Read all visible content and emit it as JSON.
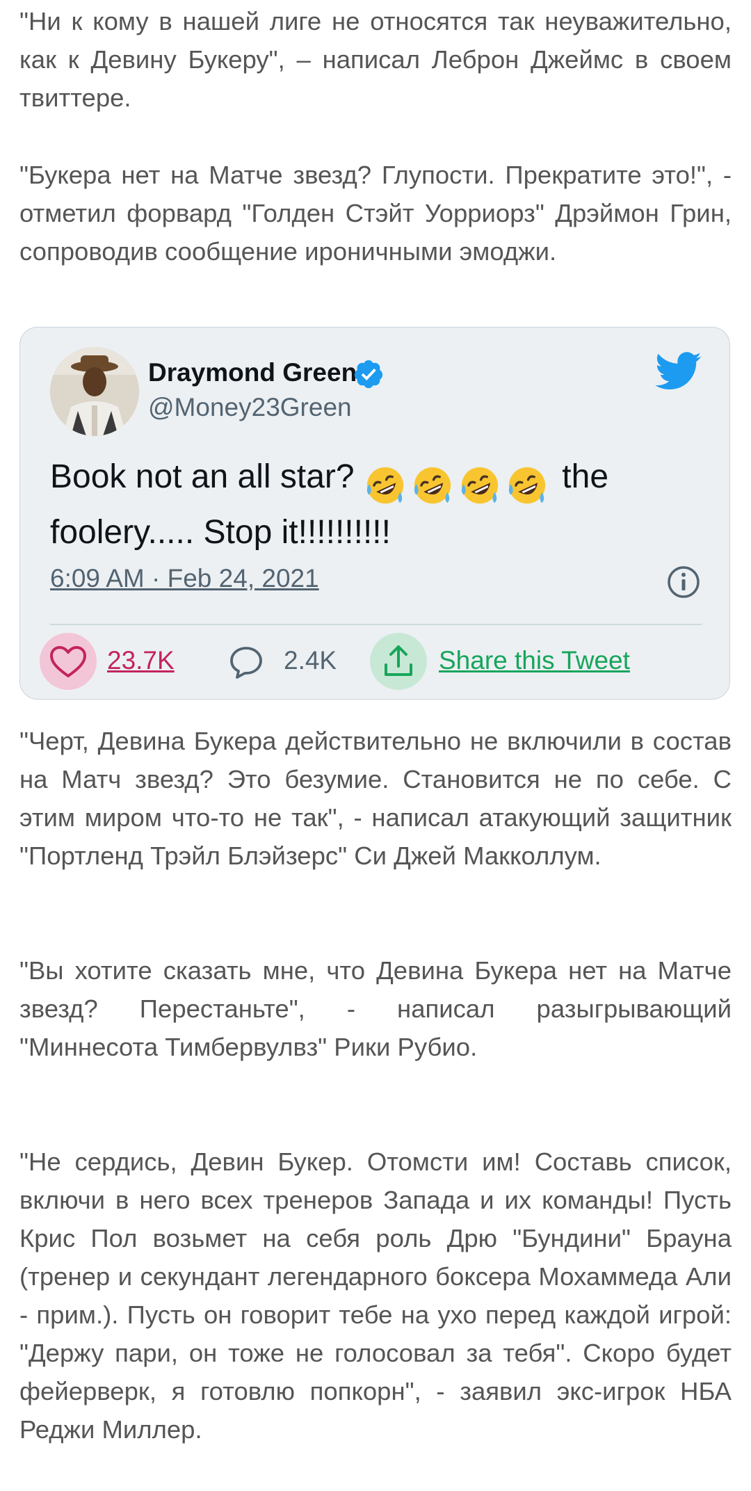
{
  "article": {
    "paragraph_1": "\"Ни к кому в нашей лиге не относятся так неуважительно, как к Девину Букеру\", – написал Леброн Джеймс в своем твиттере.",
    "paragraph_2": "\"Букера нет на Матче звезд? Глупости. Прекратите это!\", - отметил форвард \"Голден Стэйт Уорриорз\" Дрэймон Грин, сопроводив сообщение ироничными эмоджи.",
    "paragraph_3": "\"Черт, Девина Букера действительно не включили в состав на Матч звезд? Это безумие. Становится не по себе. С этим миром что-то не так\", - написал атакующий защитник \"Портленд Трэйл Блэйзерс\" Си Джей Макколлум.",
    "paragraph_4": "\"Вы хотите сказать мне, что Девина Букера нет на Матче звезд? Перестаньте\", - написал разыгрывающий \"Миннесота Тимбервулвз\" Рики Рубио.",
    "paragraph_5": "\"Не сердись, Девин Букер. Отомсти им! Составь список, включи в него всех тренеров Запада и их команды! Пусть Крис Пол возьмет на себя роль Дрю \"Бундини\" Брауна (тренер и секундант легендарного боксера Мохаммеда Али - прим.). Пусть он говорит тебе на ухо перед каждой игрой: \"Держу пари, он тоже не голосовал за тебя\". Скоро будет фейерверк, я готовлю попкорн\", - заявил экс-игрок НБА Реджи Миллер."
  },
  "tweet": {
    "author_name": "Draymond Green",
    "handle": "@Money23Green",
    "text_before_emoji": "Book not an all star?",
    "emoji_icon": "rolling-on-floor-laughing-icon",
    "emoji_count": 4,
    "text_after_emoji": "the foolery..... Stop it!!!!!!!!!!",
    "timestamp": "6:09 AM · Feb 24, 2021",
    "likes": "23.7K",
    "replies": "2.4K",
    "share_label": "Share this Tweet",
    "colors": {
      "card_background": "#ecf0f3",
      "twitter_blue": "#1d9bf0",
      "like_pink": "#c3245c",
      "share_green": "#17a55a"
    }
  }
}
